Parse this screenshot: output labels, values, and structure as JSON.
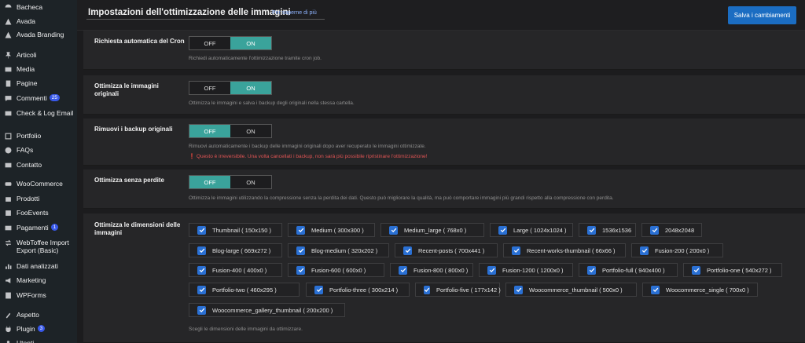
{
  "sidebar": {
    "items": [
      {
        "label": "Bacheca",
        "icon": "dashboard-icon"
      },
      {
        "label": "Avada",
        "icon": "avada-icon"
      },
      {
        "label": "Avada Branding",
        "icon": "avada-branding-icon"
      },
      {
        "label": "Articoli",
        "icon": "pin-icon"
      },
      {
        "label": "Media",
        "icon": "media-icon"
      },
      {
        "label": "Pagine",
        "icon": "pages-icon"
      },
      {
        "label": "Commenti",
        "icon": "comments-icon",
        "badge": "25"
      },
      {
        "label": "Check & Log Email",
        "icon": "email-icon"
      },
      {
        "label": "Portfolio",
        "icon": "portfolio-icon"
      },
      {
        "label": "FAQs",
        "icon": "faq-icon"
      },
      {
        "label": "Contatto",
        "icon": "contact-icon"
      },
      {
        "label": "WooCommerce",
        "icon": "woocommerce-icon"
      },
      {
        "label": "Prodotti",
        "icon": "products-icon"
      },
      {
        "label": "FooEvents",
        "icon": "fooevents-icon"
      },
      {
        "label": "Pagamenti",
        "icon": "payments-icon",
        "badge": "1"
      },
      {
        "label": "WebToffee Import Export (Basic)",
        "icon": "import-export-icon"
      },
      {
        "label": "Dati analizzati",
        "icon": "analytics-icon"
      },
      {
        "label": "Marketing",
        "icon": "marketing-icon"
      },
      {
        "label": "WPForms",
        "icon": "wpforms-icon"
      },
      {
        "label": "Aspetto",
        "icon": "appearance-icon"
      },
      {
        "label": "Plugin",
        "icon": "plugin-icon",
        "badge": "3"
      },
      {
        "label": "Utenti",
        "icon": "users-icon"
      }
    ]
  },
  "header": {
    "title": "Impostazioni dell'ottimizzazione delle immagini",
    "learn_more": "Per saperne di più",
    "save_label": "Salva i cambiamenti"
  },
  "sections": {
    "cron": {
      "label": "Richiesta automatica del Cron",
      "off": "OFF",
      "on": "ON",
      "state": "on",
      "desc": "Richiedi automaticamente l'ottimizzazione tramite cron job."
    },
    "originals": {
      "label": "Ottimizza le immagini originali",
      "off": "OFF",
      "on": "ON",
      "state": "on",
      "desc": "Ottimizza le immagini e salva i backup degli originali nella stessa cartella."
    },
    "backup": {
      "label": "Rimuovi i backup originali",
      "off": "OFF",
      "on": "ON",
      "state": "off",
      "desc": "Rimuovi automaticamente i backup delle immagini originali dopo aver recuperato le immagini ottimizzate.",
      "warning": "❗ Questo è irreversibile. Una volta cancellati i backup, non sarà più possibile ripristinare l'ottimizzazione!"
    },
    "lossless": {
      "label": "Ottimizza senza perdite",
      "off": "OFF",
      "on": "ON",
      "state": "off",
      "desc": "Ottimizza le immagini utilizzando la compressione senza la perdita dei dati. Questo può migliorare la qualità, ma può comportare immagini più grandi rispetto alla compressione con perdita."
    },
    "sizes": {
      "label": "Ottimizza le dimensioni delle immagini",
      "desc": "Scegli le dimensioni delle immagini da ottimizzare.",
      "options": [
        "Thumbnail ( 150x150 )",
        "Medium ( 300x300 )",
        "Medium_large ( 768x0 )",
        "Large ( 1024x1024 )",
        "1536x1536",
        "2048x2048",
        "Blog-large ( 669x272 )",
        "Blog-medium ( 320x202 )",
        "Recent-posts ( 700x441 )",
        "Recent-works-thumbnail ( 66x66 )",
        "Fusion-200 ( 200x0 )",
        "Fusion-400 ( 400x0 )",
        "Fusion-600 ( 600x0 )",
        "Fusion-800 ( 800x0 )",
        "Fusion-1200 ( 1200x0 )",
        "Portfolio-full ( 940x400 )",
        "Portfolio-one ( 540x272 )",
        "Portfolio-two ( 460x295 )",
        "Portfolio-three ( 300x214 )",
        "Portfolio-five ( 177x142 )",
        "Woocommerce_thumbnail ( 500x0 )",
        "Woocommerce_single ( 700x0 )",
        "Woocommerce_gallery_thumbnail ( 200x200 )"
      ]
    }
  },
  "colors": {
    "accent": "#3aa39b",
    "primary_button": "#1b6dc2",
    "checkbox": "#2a70d4",
    "warning": "#e05454",
    "sidebar_bg": "#1d2327"
  }
}
